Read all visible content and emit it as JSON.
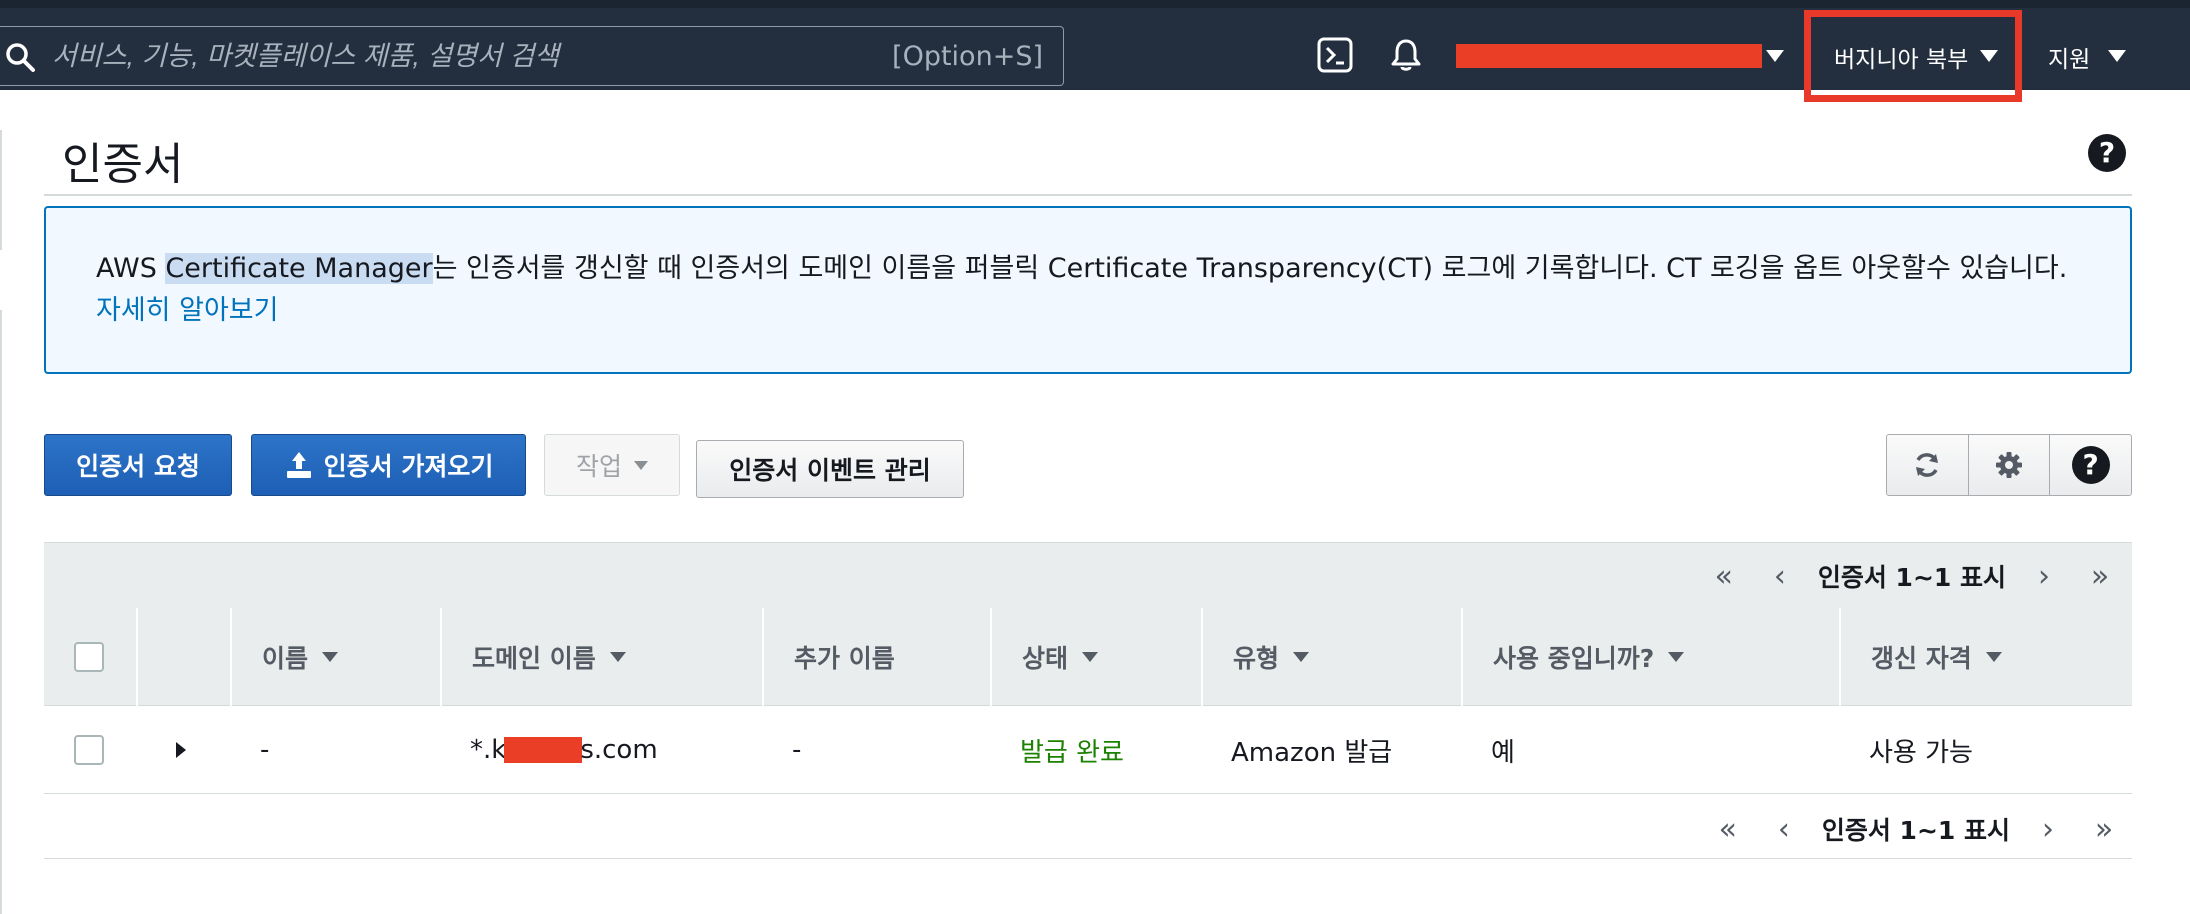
{
  "topbar": {
    "search_placeholder": "서비스, 기능, 마켓플레이스 제품, 설명서 검색",
    "search_shortcut": "[Option+S]",
    "region_label": "버지니아 북부",
    "support_label": "지원",
    "icons": [
      "search-icon",
      "cloudshell-icon",
      "bell-icon"
    ]
  },
  "page": {
    "title": "인증서"
  },
  "info": {
    "text_before": "AWS ",
    "text_highlight": "Certificate Manager",
    "text_after": "는 인증서를 갱신할 때 인증서의 도메인 이름을 퍼블릭 Certificate Transparency(CT) 로그에 기록합니다. CT 로깅을 옵트 아웃할수 있습니다. ",
    "link_text": "자세히 알아보기"
  },
  "toolbar": {
    "request_label": "인증서 요청",
    "import_label": "인증서 가져오기",
    "actions_label": "작업",
    "events_label": "인증서 이벤트 관리",
    "icons": [
      "refresh-icon",
      "gear-icon",
      "help-icon"
    ]
  },
  "pagination": {
    "summary": "인증서 1~1 표시",
    "first": "«",
    "prev": "‹",
    "next": "›",
    "last": "»"
  },
  "table": {
    "columns": [
      "이름",
      "도메인 이름",
      "추가 이름",
      "상태",
      "유형",
      "사용 중입니까?",
      "갱신 자격"
    ],
    "rows": [
      {
        "name": "-",
        "domain_prefix": "*.k",
        "domain_suffix": "s.com",
        "additional_names": "-",
        "status": "발급 완료",
        "type": "Amazon 발급",
        "in_use": "예",
        "renewal": "사용 가능"
      }
    ]
  },
  "colors": {
    "nav_bg": "#232f3e",
    "primary": "#1d5fb4",
    "link": "#0073bb",
    "success": "#1d8102",
    "redaction": "#ea3f26",
    "region_highlight": "#e8392a"
  }
}
